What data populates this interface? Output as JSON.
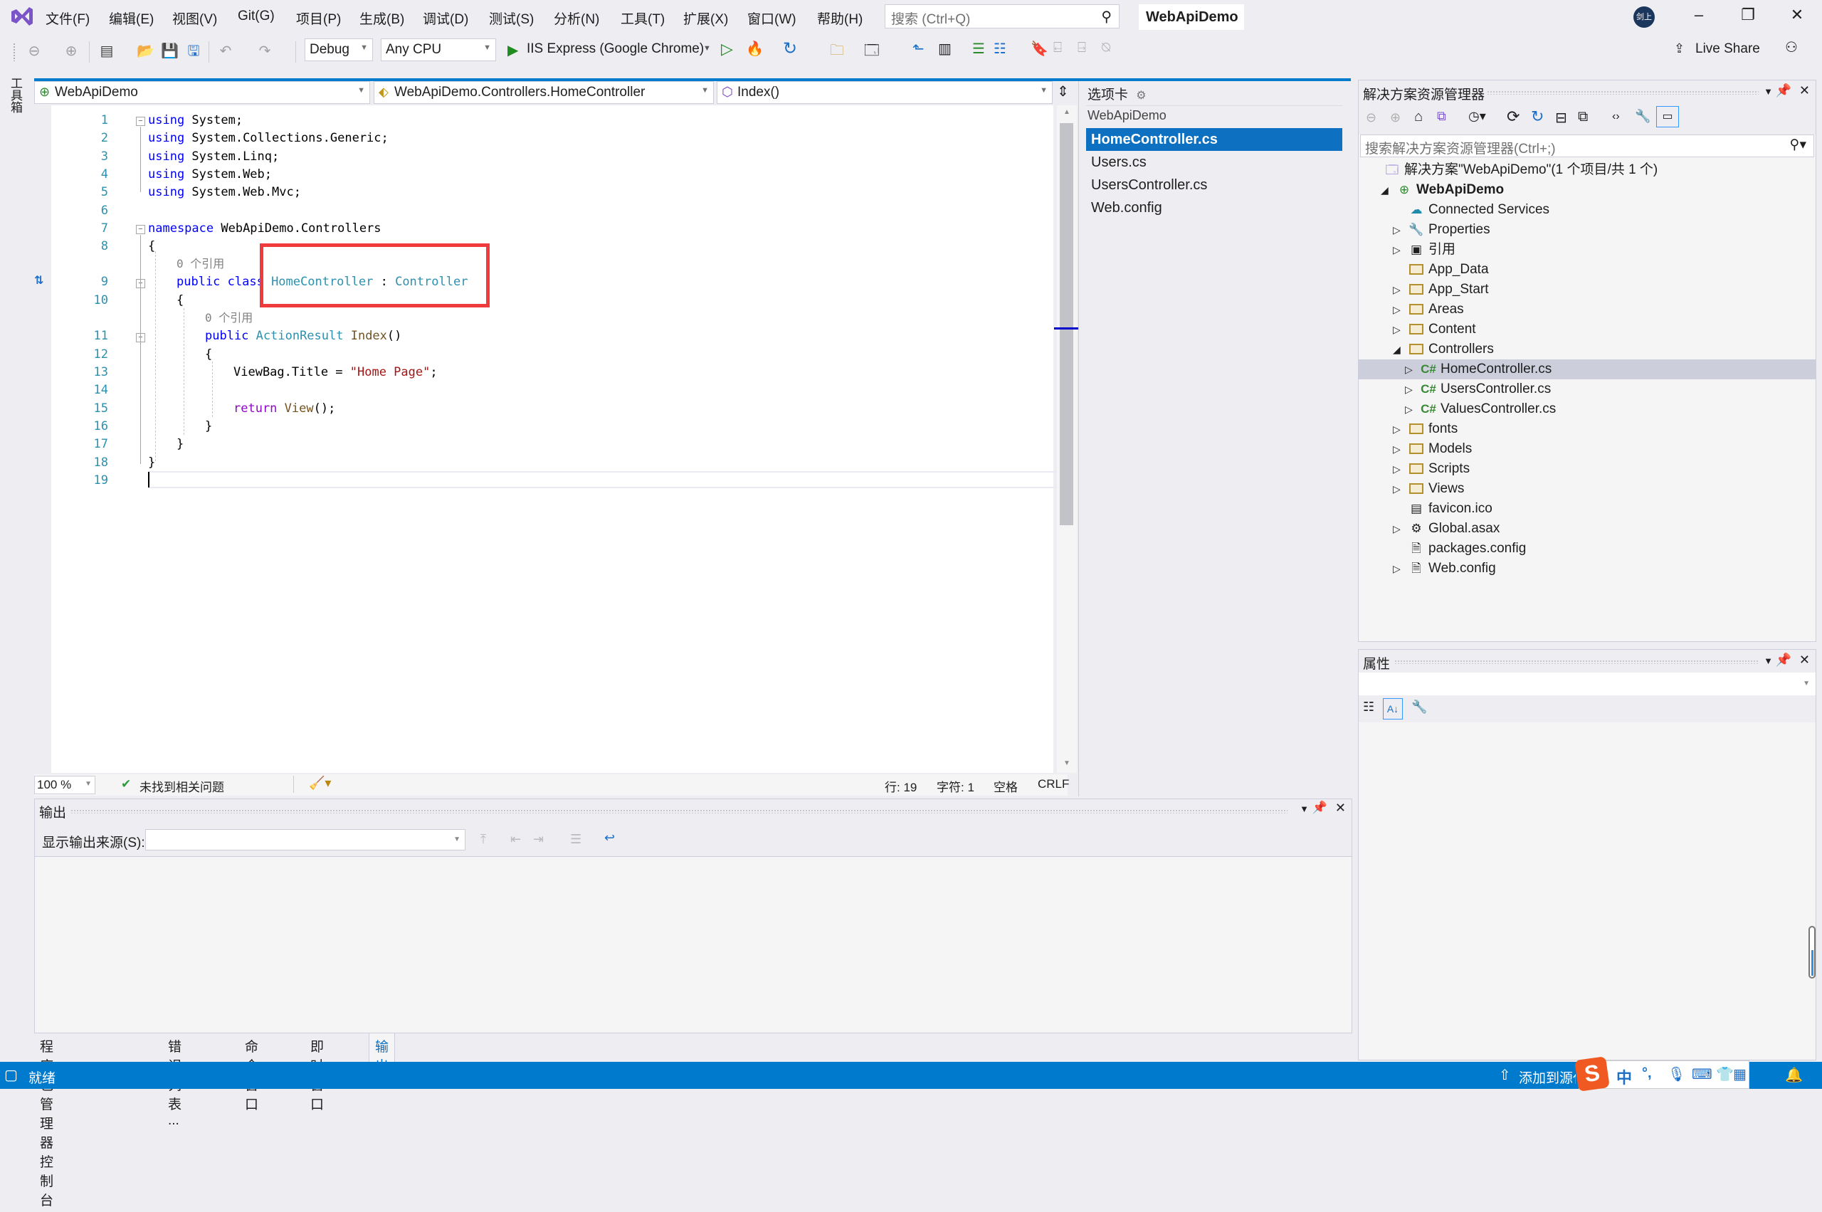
{
  "menubar": {
    "items": [
      "文件(F)",
      "编辑(E)",
      "视图(V)",
      "Git(G)",
      "项目(P)",
      "生成(B)",
      "调试(D)",
      "测试(S)",
      "分析(N)",
      "工具(T)",
      "扩展(X)",
      "窗口(W)",
      "帮助(H)"
    ],
    "search_placeholder": "搜索 (Ctrl+Q)",
    "solution_name": "WebApiDemo",
    "avatar_text": "剑上",
    "window_controls": {
      "minimize": "–",
      "restore": "❐",
      "close": "✕"
    }
  },
  "toolbar": {
    "configuration": "Debug",
    "platform": "Any CPU",
    "run_target": "IIS Express (Google Chrome)",
    "live_share": "Live Share"
  },
  "toolbox": {
    "label": "工具箱"
  },
  "editor": {
    "nav": {
      "project": "WebApiDemo",
      "type": "WebApiDemo.Controllers.HomeController",
      "member": "Index()"
    },
    "ref_hint": "0 个引用",
    "lines": [
      {
        "n": "1"
      },
      {
        "n": "2"
      },
      {
        "n": "3"
      },
      {
        "n": "4"
      },
      {
        "n": "5"
      },
      {
        "n": "6"
      },
      {
        "n": "7"
      },
      {
        "n": "8"
      },
      {
        "n": "9"
      },
      {
        "n": "10"
      },
      {
        "n": "11"
      },
      {
        "n": "12"
      },
      {
        "n": "13"
      },
      {
        "n": "14"
      },
      {
        "n": "15"
      },
      {
        "n": "16"
      },
      {
        "n": "17"
      },
      {
        "n": "18"
      },
      {
        "n": "19"
      }
    ],
    "code": {
      "using": "using",
      "l1": " System;",
      "l2": " System.Collections.Generic;",
      "l3": " System.Linq;",
      "l4": " System.Web;",
      "l5": " System.Web.Mvc;",
      "namespace_kw": "namespace",
      "namespace_name": " WebApiDemo.Controllers",
      "open_brace": "{",
      "close_brace": "}",
      "public_class": "public class ",
      "class_name": "HomeController",
      "colon": " : ",
      "base_class": "Controller",
      "public": "public ",
      "return_type": "ActionResult",
      "method": " Index",
      "parens": "()",
      "viewbag": "ViewBag.Title = ",
      "string_val": "\"Home Page\"",
      "semi": ";",
      "return_kw": "return",
      "view_call": " View",
      "view_end": "();"
    },
    "status": {
      "zoom": "100 %",
      "issues": "未找到相关问题",
      "line": "行: 19",
      "char": "字符: 1",
      "indent": "空格",
      "eol": "CRLF"
    }
  },
  "tabs_panel": {
    "title": "选项卡",
    "group": "WebApiDemo",
    "items": [
      {
        "label": "HomeController.cs",
        "active": true
      },
      {
        "label": "Users.cs",
        "active": false
      },
      {
        "label": "UsersController.cs",
        "active": false
      },
      {
        "label": "Web.config",
        "active": false
      }
    ]
  },
  "solution_explorer": {
    "title": "解决方案资源管理器",
    "search_placeholder": "搜索解决方案资源管理器(Ctrl+;)",
    "tree": [
      {
        "label": "解决方案\"WebApiDemo\"(1 个项目/共 1 个)",
        "icon": "solution-icon",
        "level": 0,
        "expander": ""
      },
      {
        "label": "WebApiDemo",
        "icon": "web-project-icon",
        "level": 1,
        "expander": "◢",
        "bold": true
      },
      {
        "label": "Connected Services",
        "icon": "connected-services-icon",
        "level": 2,
        "expander": ""
      },
      {
        "label": "Properties",
        "icon": "wrench-icon",
        "level": 2,
        "expander": "▷"
      },
      {
        "label": "引用",
        "icon": "references-icon",
        "level": 2,
        "expander": "▷"
      },
      {
        "label": "App_Data",
        "icon": "folder-icon",
        "level": 2,
        "expander": ""
      },
      {
        "label": "App_Start",
        "icon": "folder-icon",
        "level": 2,
        "expander": "▷"
      },
      {
        "label": "Areas",
        "icon": "folder-icon",
        "level": 2,
        "expander": "▷"
      },
      {
        "label": "Content",
        "icon": "folder-icon",
        "level": 2,
        "expander": "▷"
      },
      {
        "label": "Controllers",
        "icon": "folder-open-icon",
        "level": 2,
        "expander": "◢"
      },
      {
        "label": "HomeController.cs",
        "icon": "csharp-file-icon",
        "level": 3,
        "expander": "▷",
        "selected": true
      },
      {
        "label": "UsersController.cs",
        "icon": "csharp-file-icon",
        "level": 3,
        "expander": "▷"
      },
      {
        "label": "ValuesController.cs",
        "icon": "csharp-file-icon",
        "level": 3,
        "expander": "▷"
      },
      {
        "label": "fonts",
        "icon": "folder-icon",
        "level": 2,
        "expander": "▷"
      },
      {
        "label": "Models",
        "icon": "folder-icon",
        "level": 2,
        "expander": "▷"
      },
      {
        "label": "Scripts",
        "icon": "folder-icon",
        "level": 2,
        "expander": "▷"
      },
      {
        "label": "Views",
        "icon": "folder-icon",
        "level": 2,
        "expander": "▷"
      },
      {
        "label": "favicon.ico",
        "icon": "image-file-icon",
        "level": 2,
        "expander": ""
      },
      {
        "label": "Global.asax",
        "icon": "asax-file-icon",
        "level": 2,
        "expander": "▷"
      },
      {
        "label": "packages.config",
        "icon": "config-file-icon",
        "level": 2,
        "expander": ""
      },
      {
        "label": "Web.config",
        "icon": "config-file-icon",
        "level": 2,
        "expander": "▷"
      }
    ]
  },
  "properties": {
    "title": "属性"
  },
  "output": {
    "title": "输出",
    "source_label": "显示输出来源(S):",
    "source_value": ""
  },
  "bottom_tabs": [
    {
      "label": "程序包管理器控制台",
      "active": false
    },
    {
      "label": "错误列表 ...",
      "active": false
    },
    {
      "label": "命令窗口",
      "active": false
    },
    {
      "label": "即时窗口",
      "active": false
    },
    {
      "label": "输出",
      "active": true
    }
  ],
  "statusbar": {
    "ready": "就绪",
    "add_to_source": "添加到源代码管理",
    "ime_lang": "中",
    "ime_punct": "°,"
  },
  "colors": {
    "accent": "#007acc",
    "selected_tab": "#0e70c0",
    "highlight_box": "#ef3b3b"
  }
}
